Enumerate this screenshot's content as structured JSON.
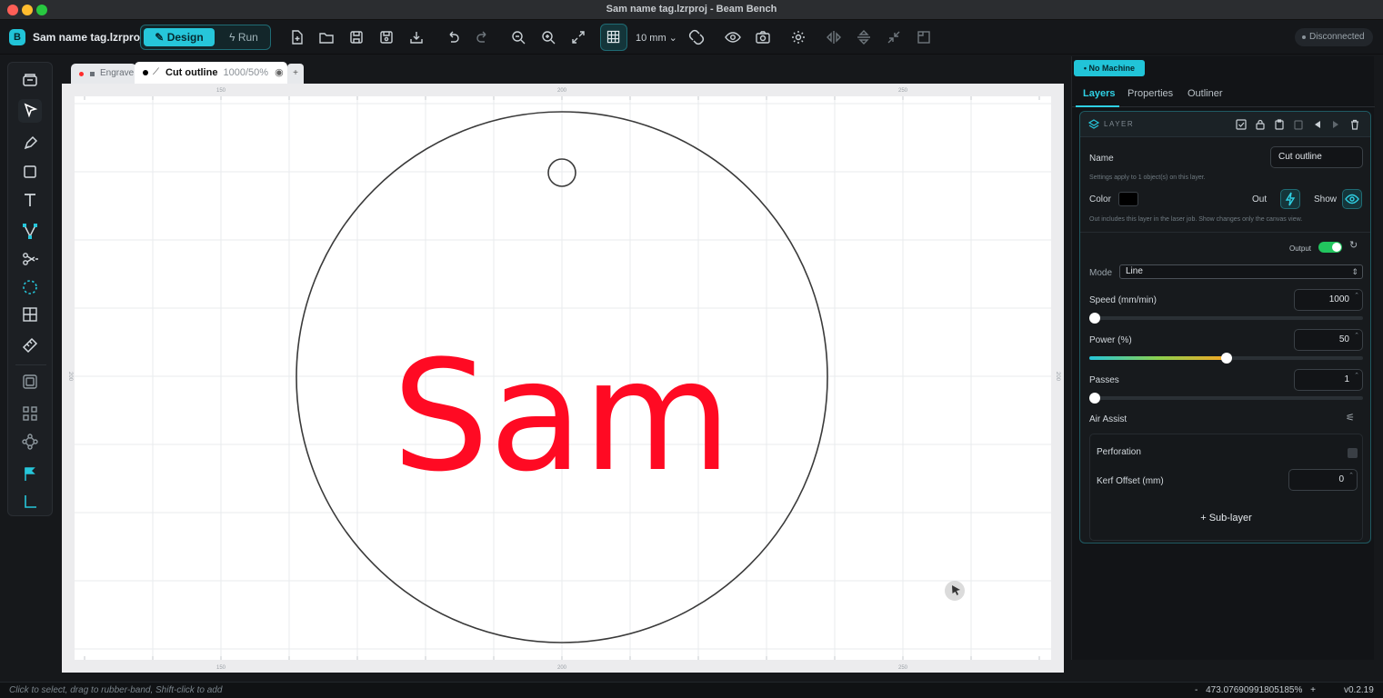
{
  "window": {
    "title": "Sam name tag.lzrproj - Beam Bench",
    "traffic_colors": [
      "#ff5f57",
      "#febc2e",
      "#28c840"
    ]
  },
  "toolbar": {
    "logo_letter": "B",
    "project_name": "Sam name tag.lzrproj",
    "mode_design": "Design",
    "mode_run": "Run",
    "grid_size": "10 mm",
    "connection_status": "Disconnected",
    "icons": [
      "new-file-icon",
      "open-folder-icon",
      "save-icon",
      "save-as-icon",
      "import-icon",
      "undo-icon",
      "redo-icon",
      "zoom-out-icon",
      "zoom-in-icon",
      "fit-screen-icon",
      "grid-icon",
      "snap-magnet-icon",
      "preview-eye-icon",
      "camera-icon",
      "settings-gear-icon",
      "flip-horizontal-icon",
      "flip-vertical-icon",
      "shrink-icon",
      "frame-icon"
    ]
  },
  "lefttools": [
    "library-icon",
    "select-cursor-icon",
    "pen-icon",
    "rectangle-icon",
    "text-icon",
    "node-edit-icon",
    "scissors-icon",
    "offset-circle-icon",
    "grid-array-icon",
    "ruler-icon",
    "layer-stack-icon",
    "group-icon",
    "path-link-icon",
    "origin-flag-icon",
    "corner-icon"
  ],
  "tabs": {
    "engrave": "Engrave",
    "cut_name": "Cut outline",
    "cut_settings": "1000/50%",
    "add": "+"
  },
  "canvas": {
    "text": "Sam",
    "text_color": "#ff0a23",
    "ruler_top": [
      "150",
      "200",
      "250"
    ],
    "ruler_bottom": [
      "150",
      "200",
      "250"
    ],
    "ruler_side": "200"
  },
  "panel": {
    "machine_badge": "• No Machine",
    "tabs": [
      "Layers",
      "Properties",
      "Outliner"
    ],
    "layer_header": "LAYER",
    "name_label": "Name",
    "name_value": "Cut outline",
    "name_hint": "Settings apply to 1 object(s) on this layer.",
    "color_label": "Color",
    "layer_color": "#000000",
    "out_label": "Out",
    "show_label": "Show",
    "out_hint": "Out includes this layer in the laser job. Show changes only the canvas view.",
    "output_label": "Output",
    "mode_label": "Mode",
    "mode_value": "Line",
    "speed_label": "Speed (mm/min)",
    "speed_value": "1000",
    "speed_fraction": 0.02,
    "power_label": "Power (%)",
    "power_value": "50",
    "power_fraction": 0.5,
    "passes_label": "Passes",
    "passes_value": "1",
    "passes_fraction": 0.0,
    "air_assist_label": "Air Assist",
    "perforation_label": "Perforation",
    "kerf_label": "Kerf Offset (mm)",
    "kerf_value": "0",
    "sublayer_button": "+ Sub-layer",
    "accent": "#26c6da"
  },
  "statusbar": {
    "hint": "Click to select, drag to rubber-band, Shift-click to add",
    "zoom_minus": "-",
    "zoom_value": "473.076909918051​85%",
    "zoom_plus": "+",
    "version": "v0.2.19"
  }
}
